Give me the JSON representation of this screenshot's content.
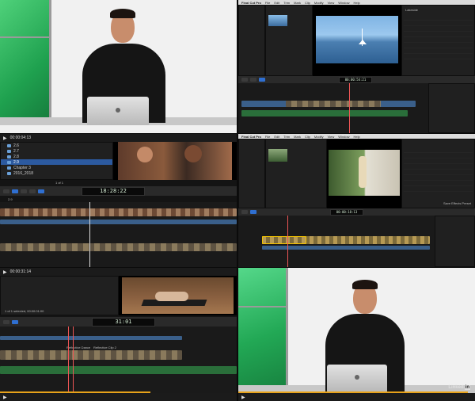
{
  "cell3": {
    "timecode": "00:00:04:13",
    "browser_items": [
      "2.6",
      "2.7",
      "2.8",
      "2.9",
      "Chapter 3",
      "2016_2018"
    ],
    "selected_index": 3,
    "count": "1 of 1",
    "big_timecode": "18:28:22",
    "timeline_label": "2.9"
  },
  "cell5": {
    "timecode": "00:00:31:14",
    "selection_label": "1 of 1 selected, 00:00:01:00",
    "big_timecode": "31:01",
    "clip_labels": [
      "Reflective Dance",
      "Reflective Clip 2"
    ]
  },
  "cell2": {
    "app_menu": [
      "Final Cut Pro",
      "File",
      "Edit",
      "Trim",
      "Mark",
      "Clip",
      "Modify",
      "View",
      "Window",
      "Help"
    ],
    "inspector_title": "Lakeside",
    "timecode": "00:00:54:21"
  },
  "cell4": {
    "app_menu": [
      "Final Cut Pro",
      "File",
      "Edit",
      "Trim",
      "Mark",
      "Clip",
      "Modify",
      "View",
      "Window",
      "Help"
    ],
    "timecode": "00:00:18:13",
    "footer": "Save Effects Preset"
  },
  "cell6": {
    "brand": "Linked",
    "brand_in": "in"
  },
  "colors": {
    "accent": "#e7a21a",
    "select": "#2c5aa0",
    "brand_green": "#1fa14f"
  }
}
